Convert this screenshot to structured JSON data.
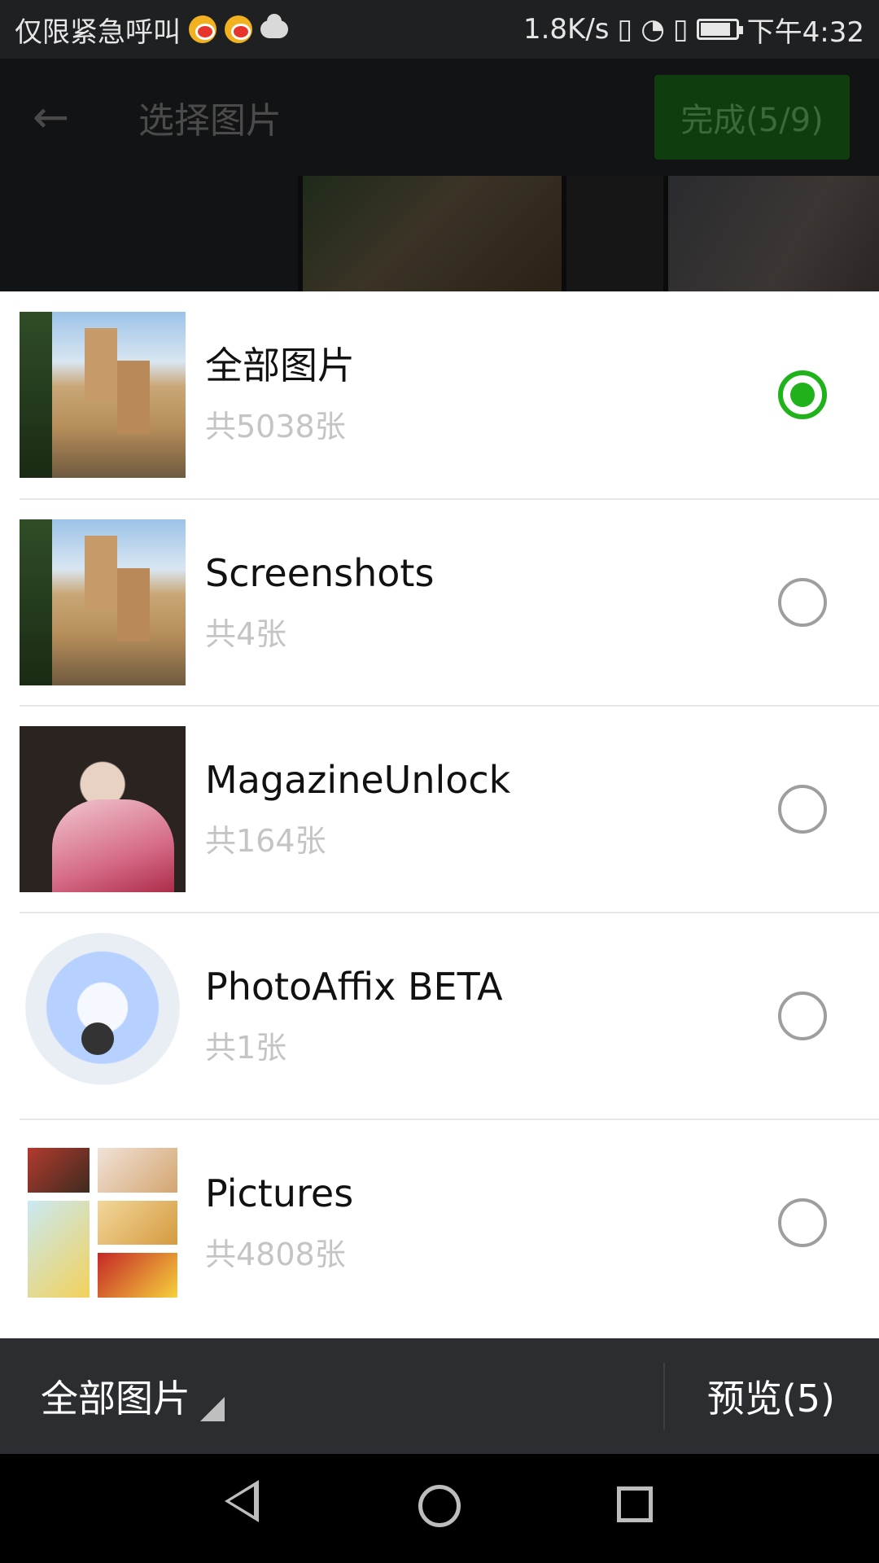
{
  "status_bar": {
    "left_text": "仅限紧急呼叫",
    "speed": "1.8K/s",
    "time": "下午4:32",
    "icons": [
      "weibo-icon",
      "weibo-icon",
      "cloud-icon",
      "vibrate-icon",
      "wifi-icon",
      "sim-alert-icon",
      "battery-icon"
    ]
  },
  "app_bar": {
    "title": "选择图片",
    "done_label": "完成(5/9)"
  },
  "albums": [
    {
      "name": "全部图片",
      "count": "共5038张",
      "selected": true,
      "thumb": "city"
    },
    {
      "name": "Screenshots",
      "count": "共4张",
      "selected": false,
      "thumb": "city"
    },
    {
      "name": "MagazineUnlock",
      "count": "共164张",
      "selected": false,
      "thumb": "woman"
    },
    {
      "name": "PhotoAffix BETA",
      "count": "共1张",
      "selected": false,
      "thumb": "globe"
    },
    {
      "name": "Pictures",
      "count": "共4808张",
      "selected": false,
      "thumb": "food"
    }
  ],
  "bottom_bar": {
    "album_label": "全部图片",
    "preview_label": "预览(5)"
  },
  "colors": {
    "accent_green": "#20b21a",
    "bottom_bar": "#2b2d30"
  }
}
